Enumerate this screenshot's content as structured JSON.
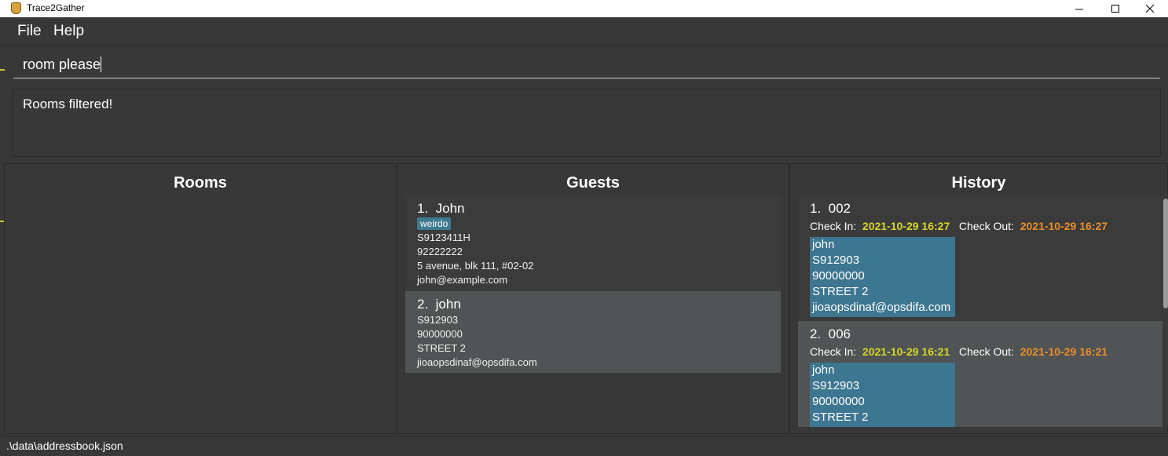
{
  "window": {
    "title": "Trace2Gather"
  },
  "menu": {
    "items": [
      "File",
      "Help"
    ]
  },
  "command": {
    "value": "room please"
  },
  "result": {
    "message": "Rooms filtered!"
  },
  "panels": {
    "rooms": "Rooms",
    "guests": "Guests",
    "history": "History"
  },
  "guests": [
    {
      "index": "1.",
      "name": "John",
      "tag": "weirdo",
      "nric": "S9123411H",
      "phone": "92222222",
      "address": "5 avenue, blk 111, #02-02",
      "email": "john@example.com"
    },
    {
      "index": "2.",
      "name": "john",
      "nric": "S912903",
      "phone": "90000000",
      "address": "STREET 2",
      "email": "jioaopsdinaf@opsdifa.com"
    }
  ],
  "history": {
    "check_in_label": "Check In:",
    "check_out_label": "Check Out:",
    "items": [
      {
        "index": "1.",
        "room": "002",
        "check_in": "2021-10-29 16:27",
        "check_out": "2021-10-29 16:27",
        "guest": {
          "name": "john",
          "nric": "S912903",
          "phone": "90000000",
          "address": "STREET 2",
          "email": "jioaopsdinaf@opsdifa.com"
        }
      },
      {
        "index": "2.",
        "room": "006",
        "check_in": "2021-10-29 16:21",
        "check_out": "2021-10-29 16:21",
        "guest": {
          "name": "john",
          "nric": "S912903",
          "phone": "90000000",
          "address": "STREET 2"
        }
      }
    ]
  },
  "status": {
    "path": ".\\data\\addressbook.json"
  },
  "colors": {
    "background": "#383838",
    "tag": "#3e7b91",
    "check_in": "#d6d62a",
    "check_out": "#e98e2a",
    "guest_box": "#3d7690"
  }
}
